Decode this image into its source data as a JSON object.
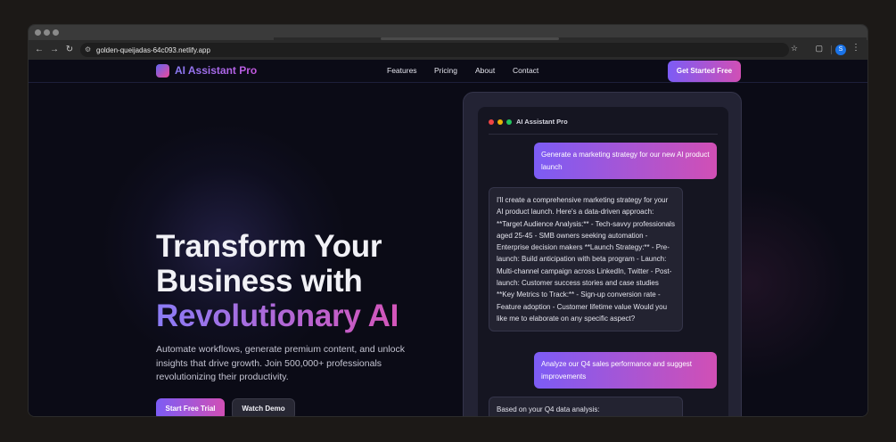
{
  "browser": {
    "url": "golden-queijadas-64c093.netlify.app",
    "profile_initial": "S"
  },
  "nav": {
    "brand": "AI Assistant Pro",
    "links": [
      "Features",
      "Pricing",
      "About",
      "Contact"
    ],
    "cta": "Get Started Free"
  },
  "hero": {
    "title_line1": "Transform Your",
    "title_line2": "Business with",
    "title_line3": "Revolutionary AI",
    "subtitle": "Automate workflows, generate premium content, and unlock insights that drive growth. Join 500,000+ professionals revolutionizing their productivity.",
    "primary_cta": "Start Free Trial",
    "secondary_cta": "Watch Demo"
  },
  "chat": {
    "title": "AI Assistant Pro",
    "messages": [
      {
        "role": "user",
        "text": "Generate a marketing strategy for our new AI product launch"
      },
      {
        "role": "assistant",
        "text": "I'll create a comprehensive marketing strategy for your AI product launch. Here's a data-driven approach: **Target Audience Analysis:** - Tech-savvy professionals aged 25-45 - SMB owners seeking automation - Enterprise decision makers **Launch Strategy:** - Pre-launch: Build anticipation with beta program - Launch: Multi-channel campaign across LinkedIn, Twitter - Post-launch: Customer success stories and case studies **Key Metrics to Track:** - Sign-up conversion rate - Feature adoption - Customer lifetime value Would you like me to elaborate on any specific aspect?"
      },
      {
        "role": "user",
        "text": "Analyze our Q4 sales performance and suggest improvements"
      },
      {
        "role": "assistant",
        "text": "Based on your Q4 data analysis:"
      }
    ]
  },
  "colors": {
    "accent_start": "#7c5cf5",
    "accent_end": "#d14fb5",
    "background": "#0b0b16"
  }
}
